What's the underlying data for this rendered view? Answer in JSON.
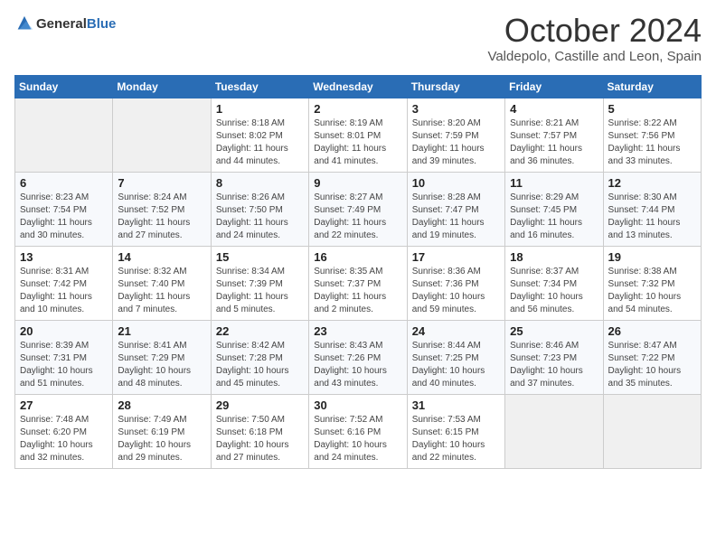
{
  "header": {
    "logo_general": "General",
    "logo_blue": "Blue",
    "month": "October 2024",
    "location": "Valdepolo, Castille and Leon, Spain"
  },
  "weekdays": [
    "Sunday",
    "Monday",
    "Tuesday",
    "Wednesday",
    "Thursday",
    "Friday",
    "Saturday"
  ],
  "weeks": [
    [
      {
        "day": "",
        "sunrise": "",
        "sunset": "",
        "daylight": ""
      },
      {
        "day": "",
        "sunrise": "",
        "sunset": "",
        "daylight": ""
      },
      {
        "day": "1",
        "sunrise": "Sunrise: 8:18 AM",
        "sunset": "Sunset: 8:02 PM",
        "daylight": "Daylight: 11 hours and 44 minutes."
      },
      {
        "day": "2",
        "sunrise": "Sunrise: 8:19 AM",
        "sunset": "Sunset: 8:01 PM",
        "daylight": "Daylight: 11 hours and 41 minutes."
      },
      {
        "day": "3",
        "sunrise": "Sunrise: 8:20 AM",
        "sunset": "Sunset: 7:59 PM",
        "daylight": "Daylight: 11 hours and 39 minutes."
      },
      {
        "day": "4",
        "sunrise": "Sunrise: 8:21 AM",
        "sunset": "Sunset: 7:57 PM",
        "daylight": "Daylight: 11 hours and 36 minutes."
      },
      {
        "day": "5",
        "sunrise": "Sunrise: 8:22 AM",
        "sunset": "Sunset: 7:56 PM",
        "daylight": "Daylight: 11 hours and 33 minutes."
      }
    ],
    [
      {
        "day": "6",
        "sunrise": "Sunrise: 8:23 AM",
        "sunset": "Sunset: 7:54 PM",
        "daylight": "Daylight: 11 hours and 30 minutes."
      },
      {
        "day": "7",
        "sunrise": "Sunrise: 8:24 AM",
        "sunset": "Sunset: 7:52 PM",
        "daylight": "Daylight: 11 hours and 27 minutes."
      },
      {
        "day": "8",
        "sunrise": "Sunrise: 8:26 AM",
        "sunset": "Sunset: 7:50 PM",
        "daylight": "Daylight: 11 hours and 24 minutes."
      },
      {
        "day": "9",
        "sunrise": "Sunrise: 8:27 AM",
        "sunset": "Sunset: 7:49 PM",
        "daylight": "Daylight: 11 hours and 22 minutes."
      },
      {
        "day": "10",
        "sunrise": "Sunrise: 8:28 AM",
        "sunset": "Sunset: 7:47 PM",
        "daylight": "Daylight: 11 hours and 19 minutes."
      },
      {
        "day": "11",
        "sunrise": "Sunrise: 8:29 AM",
        "sunset": "Sunset: 7:45 PM",
        "daylight": "Daylight: 11 hours and 16 minutes."
      },
      {
        "day": "12",
        "sunrise": "Sunrise: 8:30 AM",
        "sunset": "Sunset: 7:44 PM",
        "daylight": "Daylight: 11 hours and 13 minutes."
      }
    ],
    [
      {
        "day": "13",
        "sunrise": "Sunrise: 8:31 AM",
        "sunset": "Sunset: 7:42 PM",
        "daylight": "Daylight: 11 hours and 10 minutes."
      },
      {
        "day": "14",
        "sunrise": "Sunrise: 8:32 AM",
        "sunset": "Sunset: 7:40 PM",
        "daylight": "Daylight: 11 hours and 7 minutes."
      },
      {
        "day": "15",
        "sunrise": "Sunrise: 8:34 AM",
        "sunset": "Sunset: 7:39 PM",
        "daylight": "Daylight: 11 hours and 5 minutes."
      },
      {
        "day": "16",
        "sunrise": "Sunrise: 8:35 AM",
        "sunset": "Sunset: 7:37 PM",
        "daylight": "Daylight: 11 hours and 2 minutes."
      },
      {
        "day": "17",
        "sunrise": "Sunrise: 8:36 AM",
        "sunset": "Sunset: 7:36 PM",
        "daylight": "Daylight: 10 hours and 59 minutes."
      },
      {
        "day": "18",
        "sunrise": "Sunrise: 8:37 AM",
        "sunset": "Sunset: 7:34 PM",
        "daylight": "Daylight: 10 hours and 56 minutes."
      },
      {
        "day": "19",
        "sunrise": "Sunrise: 8:38 AM",
        "sunset": "Sunset: 7:32 PM",
        "daylight": "Daylight: 10 hours and 54 minutes."
      }
    ],
    [
      {
        "day": "20",
        "sunrise": "Sunrise: 8:39 AM",
        "sunset": "Sunset: 7:31 PM",
        "daylight": "Daylight: 10 hours and 51 minutes."
      },
      {
        "day": "21",
        "sunrise": "Sunrise: 8:41 AM",
        "sunset": "Sunset: 7:29 PM",
        "daylight": "Daylight: 10 hours and 48 minutes."
      },
      {
        "day": "22",
        "sunrise": "Sunrise: 8:42 AM",
        "sunset": "Sunset: 7:28 PM",
        "daylight": "Daylight: 10 hours and 45 minutes."
      },
      {
        "day": "23",
        "sunrise": "Sunrise: 8:43 AM",
        "sunset": "Sunset: 7:26 PM",
        "daylight": "Daylight: 10 hours and 43 minutes."
      },
      {
        "day": "24",
        "sunrise": "Sunrise: 8:44 AM",
        "sunset": "Sunset: 7:25 PM",
        "daylight": "Daylight: 10 hours and 40 minutes."
      },
      {
        "day": "25",
        "sunrise": "Sunrise: 8:46 AM",
        "sunset": "Sunset: 7:23 PM",
        "daylight": "Daylight: 10 hours and 37 minutes."
      },
      {
        "day": "26",
        "sunrise": "Sunrise: 8:47 AM",
        "sunset": "Sunset: 7:22 PM",
        "daylight": "Daylight: 10 hours and 35 minutes."
      }
    ],
    [
      {
        "day": "27",
        "sunrise": "Sunrise: 7:48 AM",
        "sunset": "Sunset: 6:20 PM",
        "daylight": "Daylight: 10 hours and 32 minutes."
      },
      {
        "day": "28",
        "sunrise": "Sunrise: 7:49 AM",
        "sunset": "Sunset: 6:19 PM",
        "daylight": "Daylight: 10 hours and 29 minutes."
      },
      {
        "day": "29",
        "sunrise": "Sunrise: 7:50 AM",
        "sunset": "Sunset: 6:18 PM",
        "daylight": "Daylight: 10 hours and 27 minutes."
      },
      {
        "day": "30",
        "sunrise": "Sunrise: 7:52 AM",
        "sunset": "Sunset: 6:16 PM",
        "daylight": "Daylight: 10 hours and 24 minutes."
      },
      {
        "day": "31",
        "sunrise": "Sunrise: 7:53 AM",
        "sunset": "Sunset: 6:15 PM",
        "daylight": "Daylight: 10 hours and 22 minutes."
      },
      {
        "day": "",
        "sunrise": "",
        "sunset": "",
        "daylight": ""
      },
      {
        "day": "",
        "sunrise": "",
        "sunset": "",
        "daylight": ""
      }
    ]
  ]
}
